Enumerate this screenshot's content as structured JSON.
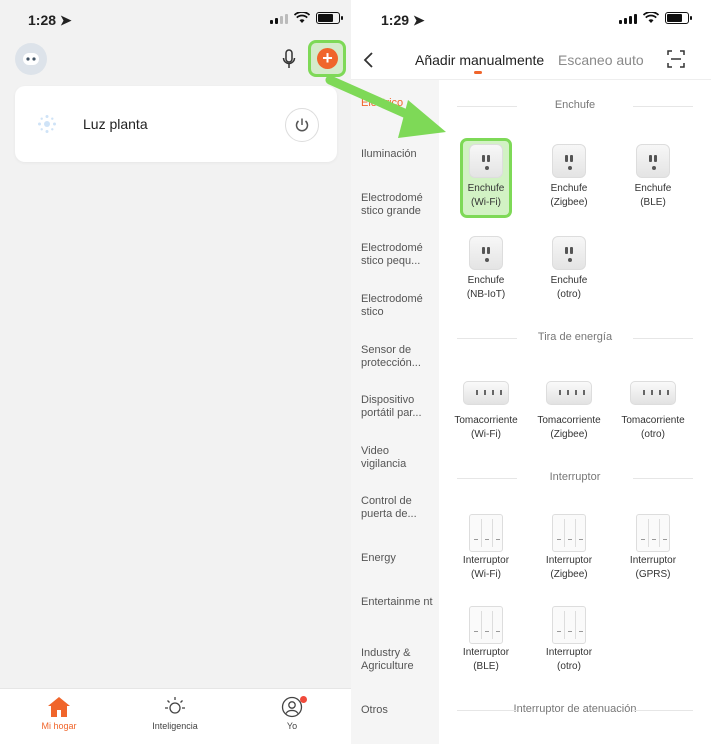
{
  "left": {
    "status": {
      "time": "1:28 ➤"
    },
    "device": {
      "name": "Luz planta"
    },
    "tabbar": [
      {
        "label": "Mi hogar",
        "icon": "home-icon"
      },
      {
        "label": "Inteligencia",
        "icon": "sun-icon"
      },
      {
        "label": "Yo",
        "icon": "profile-icon"
      }
    ],
    "add_label": "+"
  },
  "right": {
    "status": {
      "time": "1:29 ➤"
    },
    "nav": {
      "manual_tab": "Añadir manualmente",
      "auto_tab": "Escaneo auto"
    },
    "sidebar": [
      "Eléctrico",
      "Iluminación",
      "Electrodomé stico grande",
      "Electrodomé stico pequ...",
      "Electrodomé stico",
      "Sensor de protección...",
      "Dispositivo portátil par...",
      "Video vigilancia",
      "Control de puerta de...",
      "Energy",
      "Entertainme nt",
      "Industry & Agriculture",
      "Otros"
    ],
    "sections": {
      "plug": "Enchufe",
      "strip": "Tira de energía",
      "switch": "Interruptor",
      "dimmer": "Interruptor de atenuación"
    },
    "plugs": [
      {
        "name": "Enchufe",
        "sub": "(Wi-Fi)"
      },
      {
        "name": "Enchufe",
        "sub": "(Zigbee)"
      },
      {
        "name": "Enchufe",
        "sub": "(BLE)"
      },
      {
        "name": "Enchufe",
        "sub": "(NB-IoT)"
      },
      {
        "name": "Enchufe",
        "sub": "(otro)"
      }
    ],
    "strips": [
      {
        "name": "Tomacorriente",
        "sub": "(Wi-Fi)"
      },
      {
        "name": "Tomacorriente",
        "sub": "(Zigbee)"
      },
      {
        "name": "Tomacorriente",
        "sub": "(otro)"
      }
    ],
    "switches": [
      {
        "name": "Interruptor",
        "sub": "(Wi-Fi)"
      },
      {
        "name": "Interruptor",
        "sub": "(Zigbee)"
      },
      {
        "name": "Interruptor",
        "sub": "(GPRS)"
      },
      {
        "name": "Interruptor",
        "sub": "(BLE)"
      },
      {
        "name": "Interruptor",
        "sub": "(otro)"
      }
    ]
  },
  "colors": {
    "accent": "#f0652b",
    "highlight": "#7ed957"
  }
}
